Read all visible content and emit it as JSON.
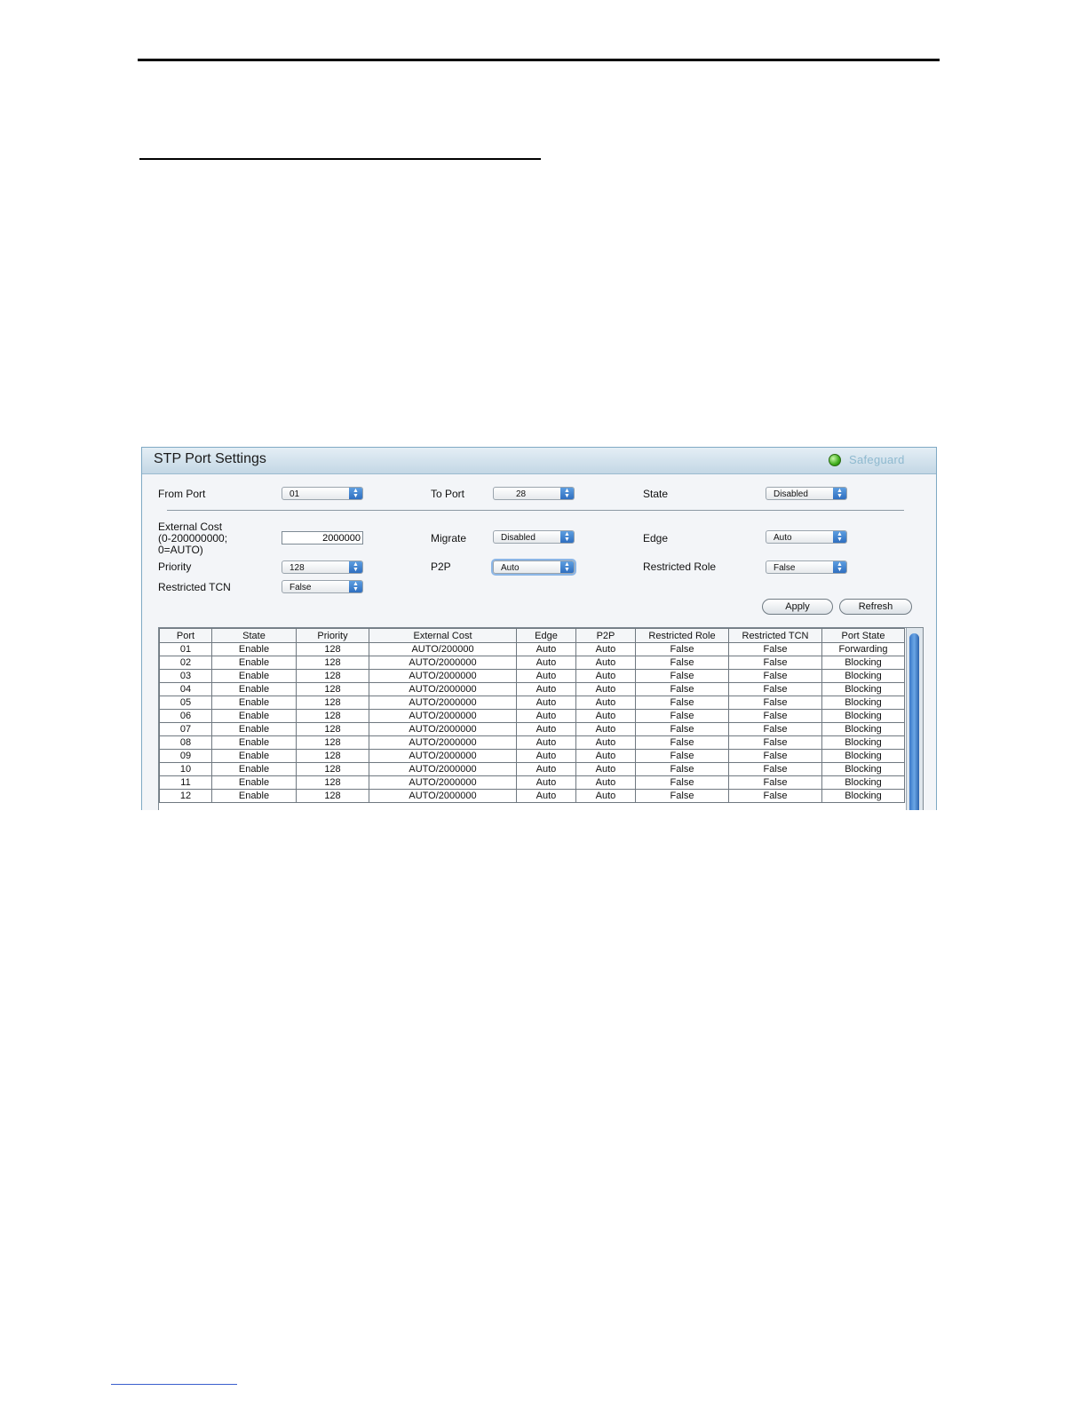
{
  "panel": {
    "title": "STP Port Settings",
    "safeguard_label": "Safeguard"
  },
  "form": {
    "from_port": {
      "label": "From Port",
      "value": "01"
    },
    "to_port": {
      "label": "To Port",
      "value": "28"
    },
    "state": {
      "label": "State",
      "value": "Disabled"
    },
    "external_cost": {
      "label_line1": "External Cost",
      "label_line2": "(0-200000000;",
      "label_line3": "0=AUTO)",
      "value": "2000000"
    },
    "migrate": {
      "label": "Migrate",
      "value": "Disabled"
    },
    "edge": {
      "label": "Edge",
      "value": "Auto"
    },
    "priority": {
      "label": "Priority",
      "value": "128"
    },
    "p2p": {
      "label": "P2P",
      "value": "Auto"
    },
    "restricted_role": {
      "label": "Restricted Role",
      "value": "False"
    },
    "restricted_tcn": {
      "label": "Restricted TCN",
      "value": "False"
    }
  },
  "buttons": {
    "apply": "Apply",
    "refresh": "Refresh"
  },
  "table": {
    "headers": [
      "Port",
      "State",
      "Priority",
      "External Cost",
      "Edge",
      "P2P",
      "Restricted Role",
      "Restricted TCN",
      "Port State"
    ],
    "rows": [
      [
        "01",
        "Enable",
        "128",
        "AUTO/200000",
        "Auto",
        "Auto",
        "False",
        "False",
        "Forwarding"
      ],
      [
        "02",
        "Enable",
        "128",
        "AUTO/2000000",
        "Auto",
        "Auto",
        "False",
        "False",
        "Blocking"
      ],
      [
        "03",
        "Enable",
        "128",
        "AUTO/2000000",
        "Auto",
        "Auto",
        "False",
        "False",
        "Blocking"
      ],
      [
        "04",
        "Enable",
        "128",
        "AUTO/2000000",
        "Auto",
        "Auto",
        "False",
        "False",
        "Blocking"
      ],
      [
        "05",
        "Enable",
        "128",
        "AUTO/2000000",
        "Auto",
        "Auto",
        "False",
        "False",
        "Blocking"
      ],
      [
        "06",
        "Enable",
        "128",
        "AUTO/2000000",
        "Auto",
        "Auto",
        "False",
        "False",
        "Blocking"
      ],
      [
        "07",
        "Enable",
        "128",
        "AUTO/2000000",
        "Auto",
        "Auto",
        "False",
        "False",
        "Blocking"
      ],
      [
        "08",
        "Enable",
        "128",
        "AUTO/2000000",
        "Auto",
        "Auto",
        "False",
        "False",
        "Blocking"
      ],
      [
        "09",
        "Enable",
        "128",
        "AUTO/2000000",
        "Auto",
        "Auto",
        "False",
        "False",
        "Blocking"
      ],
      [
        "10",
        "Enable",
        "128",
        "AUTO/2000000",
        "Auto",
        "Auto",
        "False",
        "False",
        "Blocking"
      ],
      [
        "11",
        "Enable",
        "128",
        "AUTO/2000000",
        "Auto",
        "Auto",
        "False",
        "False",
        "Blocking"
      ],
      [
        "12",
        "Enable",
        "128",
        "AUTO/2000000",
        "Auto",
        "Auto",
        "False",
        "False",
        "Blocking"
      ]
    ]
  },
  "colors": {
    "header_gradient_top": "#e4eef5",
    "header_gradient_bottom": "#c3d7e5",
    "safeguard_led": "#3fae1c",
    "select_arrow": "#2f6fc0"
  },
  "icons": {
    "safeguard": "status-led-icon",
    "dropdown": "chevron-up-down-icon"
  }
}
